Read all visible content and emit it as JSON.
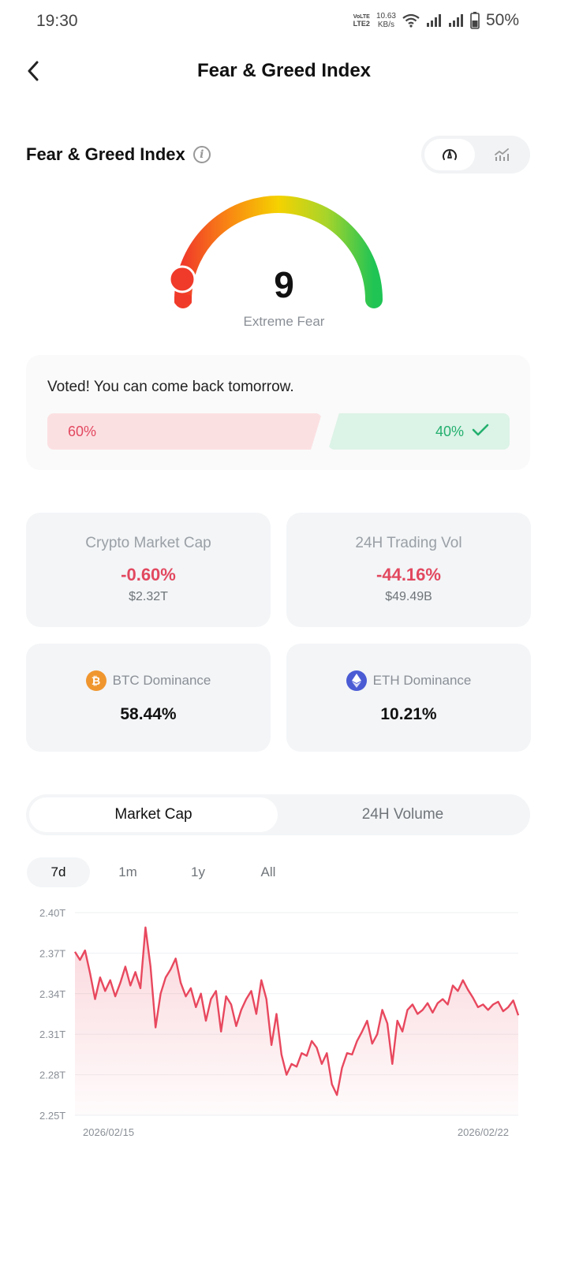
{
  "status_bar": {
    "time": "19:30",
    "volte_top": "VoLTE",
    "volte_bottom": "LTE2",
    "speed_value": "10.63",
    "speed_unit": "KB/s",
    "battery": "50%"
  },
  "header": {
    "title": "Fear & Greed Index"
  },
  "index_section": {
    "title": "Fear & Greed Index",
    "value": "9",
    "value_numeric": 9,
    "label": "Extreme Fear"
  },
  "vote": {
    "message": "Voted! You can come back tomorrow.",
    "fear_percent": "60%",
    "greed_percent": "40%",
    "fear_color": "#e2485f",
    "greed_color": "#23b06e"
  },
  "stats": {
    "market_cap": {
      "label": "Crypto Market Cap",
      "change": "-0.60%",
      "value": "$2.32T"
    },
    "trading_vol": {
      "label": "24H Trading Vol",
      "change": "-44.16%",
      "value": "$49.49B"
    },
    "btc": {
      "label": "BTC Dominance",
      "value": "58.44%",
      "icon": "bitcoin-icon",
      "color": "#f0962f"
    },
    "eth": {
      "label": "ETH Dominance",
      "value": "10.21%",
      "icon": "ethereum-icon",
      "color": "#4a5bd4"
    }
  },
  "chart_tabs": {
    "market_cap": "Market Cap",
    "volume": "24H Volume"
  },
  "ranges": [
    "7d",
    "1m",
    "1y",
    "All"
  ],
  "chart_data": {
    "type": "area",
    "title": "",
    "xlabel": "",
    "ylabel": "",
    "y_tick_labels": [
      "2.40T",
      "2.37T",
      "2.34T",
      "2.31T",
      "2.28T",
      "2.25T"
    ],
    "ylim": [
      2.25,
      2.4
    ],
    "x_tick_labels": [
      "2026/02/15",
      "2026/02/22"
    ],
    "grid": true,
    "line_color": "#e8485e",
    "series": [
      {
        "values": [
          2.371,
          2.365,
          2.372,
          2.355,
          2.336,
          2.352,
          2.342,
          2.35,
          2.338,
          2.348,
          2.36,
          2.346,
          2.356,
          2.344,
          2.389,
          2.36,
          2.315,
          2.34,
          2.352,
          2.358,
          2.366,
          2.348,
          2.338,
          2.344,
          2.33,
          2.34,
          2.32,
          2.336,
          2.342,
          2.312,
          2.338,
          2.332,
          2.316,
          2.328,
          2.336,
          2.342,
          2.325,
          2.35,
          2.336,
          2.302,
          2.325,
          2.295,
          2.28,
          2.288,
          2.286,
          2.296,
          2.294,
          2.305,
          2.3,
          2.288,
          2.296,
          2.273,
          2.265,
          2.285,
          2.296,
          2.295,
          2.305,
          2.312,
          2.32,
          2.303,
          2.31,
          2.328,
          2.318,
          2.288,
          2.32,
          2.312,
          2.328,
          2.332,
          2.325,
          2.328,
          2.333,
          2.326,
          2.333,
          2.336,
          2.332,
          2.346,
          2.342,
          2.35,
          2.343,
          2.337,
          2.33,
          2.332,
          2.328,
          2.332,
          2.334,
          2.327,
          2.33,
          2.335,
          2.324
        ]
      }
    ]
  }
}
